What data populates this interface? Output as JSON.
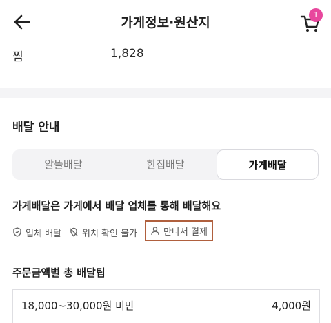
{
  "header": {
    "title": "가게정보·원산지",
    "cart_badge": "1"
  },
  "stats": {
    "label": "찜",
    "value": "1,828"
  },
  "delivery": {
    "section_title": "배달 안내",
    "tabs": [
      {
        "label": "알뜰배달",
        "active": false
      },
      {
        "label": "한집배달",
        "active": false
      },
      {
        "label": "가게배달",
        "active": true
      }
    ],
    "description": "가게배달은 가게에서 배달 업체를 통해 배달해요",
    "features": [
      {
        "icon": "shield-icon",
        "label": "업체 배달"
      },
      {
        "icon": "location-off-icon",
        "label": "위치 확인 불가"
      },
      {
        "icon": "person-icon",
        "label": "만나서 결제"
      }
    ],
    "fee_table_title": "주문금액별 총 배달팁",
    "fee_rows": [
      {
        "range": "18,000~30,000원 미만",
        "fee": "4,000원"
      }
    ]
  },
  "colors": {
    "badge": "#e8479d",
    "highlight_border": "#b0603e"
  }
}
